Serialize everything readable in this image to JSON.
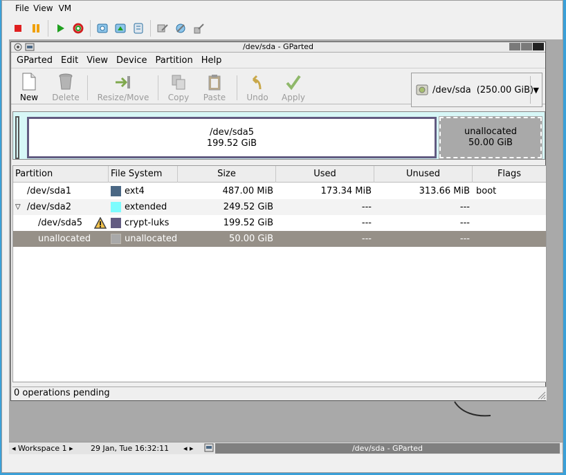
{
  "host": {
    "menu": [
      "File",
      "View",
      "VM"
    ]
  },
  "window": {
    "title": "/dev/sda - GParted"
  },
  "menu": [
    "GParted",
    "Edit",
    "View",
    "Device",
    "Partition",
    "Help"
  ],
  "toolbar": {
    "new": "New",
    "delete": "Delete",
    "resize": "Resize/Move",
    "copy": "Copy",
    "paste": "Paste",
    "undo": "Undo",
    "apply": "Apply"
  },
  "device": {
    "name": "/dev/sda",
    "size": "(250.00 GiB)"
  },
  "disk_graphic": {
    "main_name": "/dev/sda5",
    "main_size": "199.52 GiB",
    "unalloc_name": "unallocated",
    "unalloc_size": "50.00 GiB"
  },
  "table": {
    "headers": [
      "Partition",
      "File System",
      "Size",
      "Used",
      "Unused",
      "Flags"
    ],
    "rows": [
      {
        "partition": "/dev/sda1",
        "fs": "ext4",
        "fs_color": "#4a6784",
        "size": "487.00 MiB",
        "used": "173.34 MiB",
        "unused": "313.66 MiB",
        "flags": "boot"
      },
      {
        "partition": "/dev/sda2",
        "fs": "extended",
        "fs_color": "#7dfcfe",
        "size": "249.52 GiB",
        "used": "---",
        "unused": "---",
        "flags": ""
      },
      {
        "partition": "/dev/sda5",
        "fs": "crypt-luks",
        "fs_color": "#625b81",
        "size": "199.52 GiB",
        "used": "---",
        "unused": "---",
        "flags": ""
      },
      {
        "partition": "unallocated",
        "fs": "unallocated",
        "fs_color": "#a9a9a9",
        "size": "50.00 GiB",
        "used": "---",
        "unused": "---",
        "flags": ""
      }
    ]
  },
  "status": "0 operations pending",
  "taskbar": {
    "workspace": "Workspace 1",
    "clock": "29 Jan, Tue 16:32:11",
    "task": "/dev/sda - GParted"
  },
  "colors": {
    "extended_border": "#7dfcfe",
    "luks_border": "#625b81",
    "selection": "#969088"
  }
}
